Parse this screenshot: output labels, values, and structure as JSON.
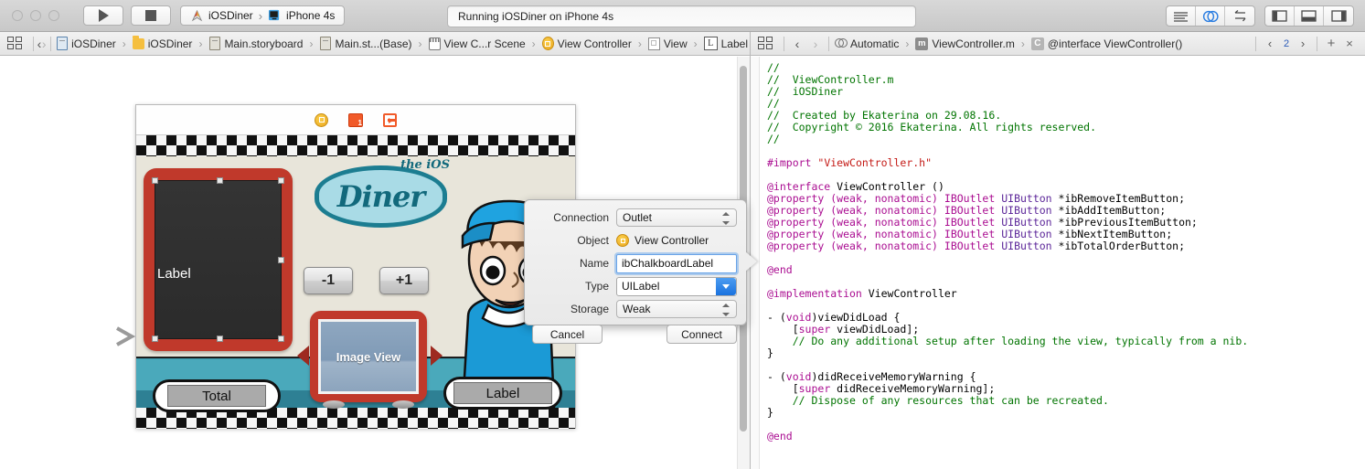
{
  "toolbar": {
    "run_icon": "play-icon",
    "stop_icon": "stop-icon",
    "scheme_project": "iOSDiner",
    "scheme_sep": "›",
    "scheme_device": "iPhone 4s",
    "status": "Running iOSDiner on iPhone 4s",
    "right_group_1": [
      "standard-editor-icon",
      "assistant-editor-icon",
      "version-editor-icon"
    ],
    "right_group_2": [
      "navigator-toggle-icon",
      "debug-area-toggle-icon",
      "utilities-toggle-icon"
    ]
  },
  "jumpbar_left": {
    "grid_icon": "related-items-icon",
    "back_icon": "‹",
    "forward_icon": "›",
    "crumbs": [
      {
        "icon": "project-file-icon",
        "label": "iOSDiner"
      },
      {
        "icon": "folder-icon",
        "label": "iOSDiner"
      },
      {
        "icon": "storyboard-file-icon",
        "label": "Main.storyboard"
      },
      {
        "icon": "storyboard-file-icon",
        "label": "Main.st...(Base)"
      },
      {
        "icon": "scene-icon",
        "label": "View C...r Scene"
      },
      {
        "icon": "view-controller-icon",
        "label": "View Controller"
      },
      {
        "icon": "view-icon",
        "label": "View"
      },
      {
        "icon": "label-icon",
        "label": "Label",
        "badge": "L"
      }
    ]
  },
  "jumpbar_right": {
    "grid_icon": "related-items-icon",
    "back_icon": "‹",
    "forward_icon": "›",
    "crumbs": [
      {
        "icon": "assistant-automatic-icon",
        "label": "Automatic"
      },
      {
        "icon": "objc-m-file-icon",
        "label": "ViewController.m",
        "badge": "m"
      },
      {
        "icon": "category-icon",
        "label": "@interface ViewController()",
        "badge": "C"
      }
    ],
    "prev_icon": "‹",
    "counter": "2",
    "next_icon": "›",
    "add_icon": "+",
    "close_icon": "×"
  },
  "canvas": {
    "entry_point_icon": "storyboard-entry-point-arrow",
    "scene_dock": [
      {
        "icon": "view-controller-dock-icon",
        "name": "View Controller"
      },
      {
        "icon": "first-responder-dock-icon",
        "name": "First Responder"
      },
      {
        "icon": "exit-dock-icon",
        "name": "Exit"
      }
    ],
    "chalkboard_label": "Label",
    "logo_main": "Diner",
    "logo_small": "the iOS",
    "button_minus": "-1",
    "button_plus": "+1",
    "image_view_label": "Image View",
    "plaque_total": "Total",
    "plaque_label": "Label"
  },
  "popup": {
    "connection_label": "Connection",
    "connection_value": "Outlet",
    "object_label": "Object",
    "object_value": "View Controller",
    "name_label": "Name",
    "name_value": "ibChalkboardLabel",
    "type_label": "Type",
    "type_value": "UILabel",
    "storage_label": "Storage",
    "storage_value": "Weak",
    "cancel_button": "Cancel",
    "connect_button": "Connect"
  },
  "editor": {
    "filename": "ViewController.m",
    "code_lines": [
      {
        "t": "comment",
        "text": "//"
      },
      {
        "t": "comment",
        "text": "//  ViewController.m"
      },
      {
        "t": "comment",
        "text": "//  iOSDiner"
      },
      {
        "t": "comment",
        "text": "//"
      },
      {
        "t": "comment",
        "text": "//  Created by Ekaterina on 29.08.16."
      },
      {
        "t": "comment",
        "text": "//  Copyright © 2016 Ekaterina. All rights reserved."
      },
      {
        "t": "comment",
        "text": "//"
      },
      {
        "t": "blank",
        "text": ""
      },
      {
        "t": "import",
        "text": "#import \"ViewController.h\""
      },
      {
        "t": "blank",
        "text": ""
      },
      {
        "t": "interface",
        "text": "@interface ViewController ()"
      },
      {
        "t": "property",
        "text": "@property (weak, nonatomic) IBOutlet UIButton *ibRemoveItemButton;"
      },
      {
        "t": "property",
        "text": "@property (weak, nonatomic) IBOutlet UIButton *ibAddItemButton;"
      },
      {
        "t": "property",
        "text": "@property (weak, nonatomic) IBOutlet UIButton *ibPreviousItemButton;"
      },
      {
        "t": "property",
        "text": "@property (weak, nonatomic) IBOutlet UIButton *ibNextItemButton;"
      },
      {
        "t": "property",
        "text": "@property (weak, nonatomic) IBOutlet UIButton *ibTotalOrderButton;"
      },
      {
        "t": "blank",
        "text": ""
      },
      {
        "t": "keyword",
        "text": "@end"
      },
      {
        "t": "blank",
        "text": ""
      },
      {
        "t": "impl",
        "text": "@implementation ViewController"
      },
      {
        "t": "blank",
        "text": ""
      },
      {
        "t": "method",
        "text": "- (void)viewDidLoad {"
      },
      {
        "t": "super",
        "text": "    [super viewDidLoad];"
      },
      {
        "t": "comment-i",
        "text": "    // Do any additional setup after loading the view, typically from a nib."
      },
      {
        "t": "brace",
        "text": "}"
      },
      {
        "t": "blank",
        "text": ""
      },
      {
        "t": "method2",
        "text": "- (void)didReceiveMemoryWarning {"
      },
      {
        "t": "super2",
        "text": "    [super didReceiveMemoryWarning];"
      },
      {
        "t": "comment-i",
        "text": "    // Dispose of any resources that can be recreated."
      },
      {
        "t": "brace",
        "text": "}"
      },
      {
        "t": "blank",
        "text": ""
      },
      {
        "t": "keyword",
        "text": "@end"
      }
    ]
  },
  "colors": {
    "accent_red": "#c0392b",
    "teal": "#12697c",
    "comment_green": "#007400",
    "keyword_magenta": "#aa0d91",
    "string_red": "#c41a16",
    "type_purple": "#5c2699",
    "focus_blue": "#6aa4e8"
  }
}
